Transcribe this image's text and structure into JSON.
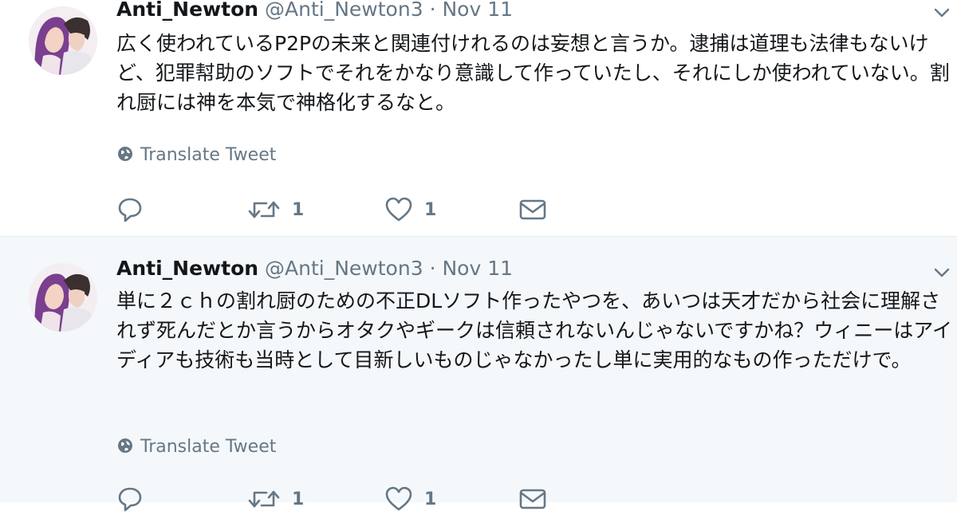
{
  "tweets": [
    {
      "display_name": "Anti_Newton",
      "handle": "@Anti_Newton3",
      "separator": "·",
      "date": "Nov 11",
      "text": "広く使われているP2Pの未来と関連付けれるのは妄想と言うか。逮捕は道理も法律もないけど、犯罪幇助のソフトでそれをかなり意識して作っていたし、それにしか使われていない。割れ厨には神を本気で神格化するなと。",
      "translate_label": "Translate Tweet",
      "retweet_count": "1",
      "like_count": "1"
    },
    {
      "display_name": "Anti_Newton",
      "handle": "@Anti_Newton3",
      "separator": "·",
      "date": "Nov 11",
      "text": "単に２ｃｈの割れ厨のための不正DLソフト作ったやつを、あいつは天才だから社会に理解されず死んだとか言うからオタクやギークは信頼されないんじゃないですかね？ウィニーはアイディアも技術も当時として目新しいものじゃなかったし単に実用的なもの作っただけで。",
      "translate_label": "Translate Tweet",
      "retweet_count": "1",
      "like_count": "1"
    }
  ],
  "icons": {
    "reply": "speech-bubble-icon",
    "retweet": "retweet-arrows-icon",
    "like": "heart-icon",
    "dm": "envelope-icon",
    "translate": "globe-icon",
    "menu": "chevron-down-icon"
  },
  "colors": {
    "text": "#14171a",
    "secondary": "#657786",
    "alt_background": "#f5f8fa",
    "divider": "#e6ecf0"
  }
}
